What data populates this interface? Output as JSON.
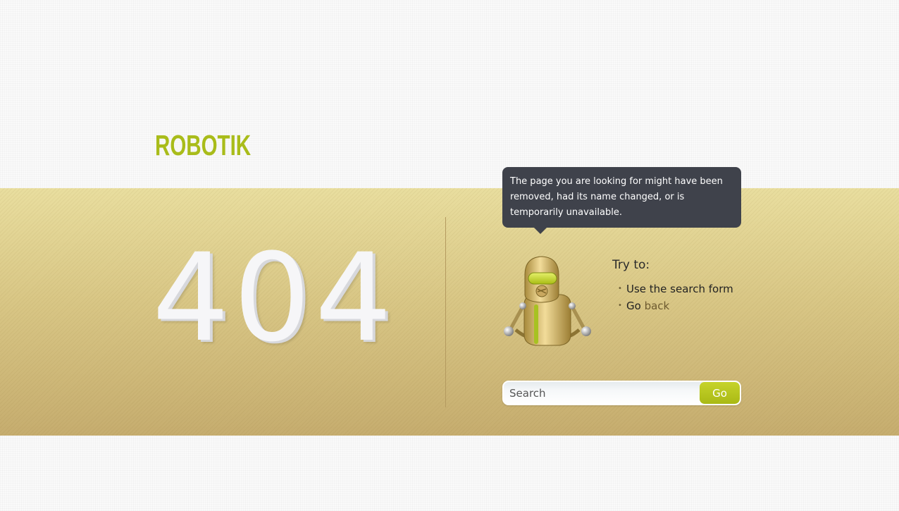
{
  "brand": {
    "logo_text": "ROBOTIK",
    "color": "#a9bc1a"
  },
  "error": {
    "code": "404",
    "message": "The page you are looking for might have been removed, had its name changed, or is temporarily unavailable."
  },
  "suggestions": {
    "title": "Try to:",
    "items": [
      {
        "text": "Use the search form"
      },
      {
        "prefix": "Go ",
        "link": "back"
      }
    ]
  },
  "search": {
    "placeholder": "Search",
    "button_label": "Go"
  },
  "icons": {
    "robot": "robot-mascot-icon"
  },
  "colors": {
    "bubble": "#3f424b",
    "band_top": "#e9de9f",
    "band_bottom": "#c6ad6f",
    "button": "#b3c21e"
  }
}
